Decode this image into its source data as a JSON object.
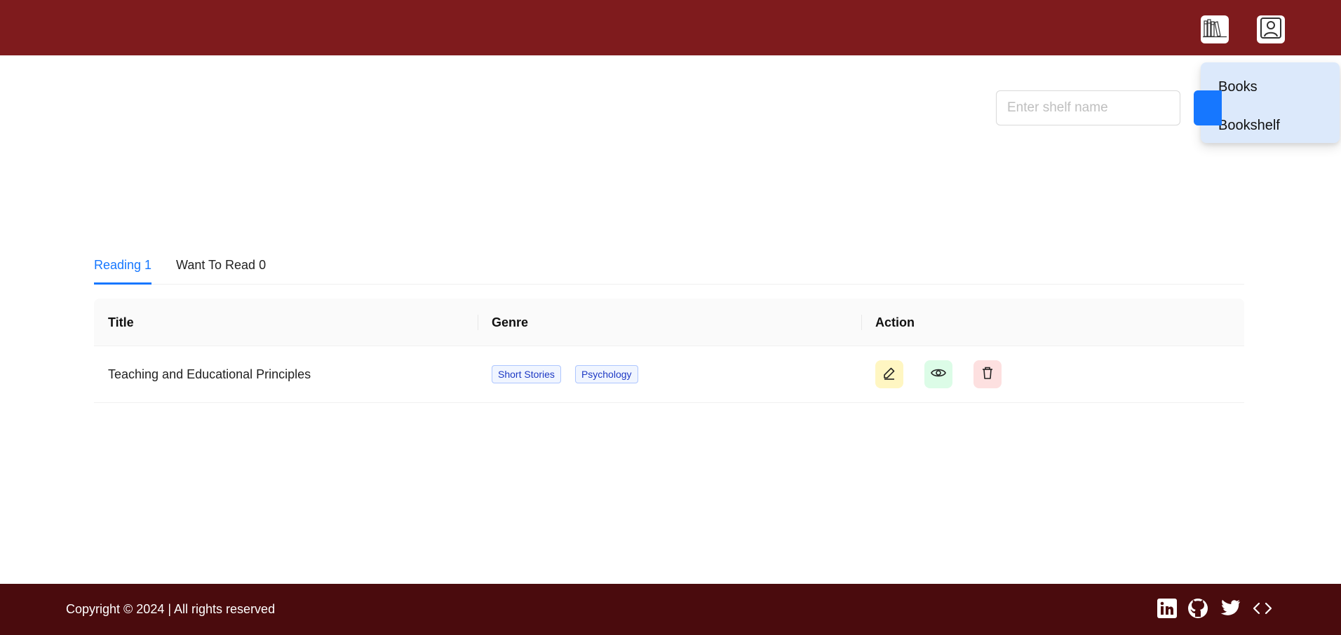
{
  "header": {
    "nav_icons": [
      "books-icon",
      "user-profile-icon"
    ],
    "background_color": "#7f1b1d"
  },
  "menu": {
    "items": [
      {
        "label": "Books"
      },
      {
        "label": "Bookshelf"
      }
    ],
    "background_color": "#dce9fb"
  },
  "shelf_form": {
    "input_placeholder": "Enter shelf name",
    "input_value": "",
    "button_color": "#1677ff"
  },
  "tabs": [
    {
      "label": "Reading 1",
      "active": true
    },
    {
      "label": "Want To Read 0",
      "active": false
    }
  ],
  "table": {
    "columns": [
      "Title",
      "Genre",
      "Action"
    ],
    "rows": [
      {
        "title": "Teaching and Educational Principles",
        "genres": [
          "Short Stories",
          "Psychology"
        ],
        "actions": [
          "edit-icon",
          "view-icon",
          "delete-icon"
        ]
      }
    ]
  },
  "footer": {
    "copyright": "Copyright © 2024 | All rights reserved",
    "social_icons": [
      "linkedin-icon",
      "github-icon",
      "twitter-icon",
      "code-icon"
    ],
    "background_color": "#4a0b0d"
  },
  "colors": {
    "accent": "#1677ff",
    "tag_text": "#1d39c4",
    "edit_bg": "#fff6c2",
    "view_bg": "#dcfce7",
    "delete_bg": "#fde0e0"
  }
}
